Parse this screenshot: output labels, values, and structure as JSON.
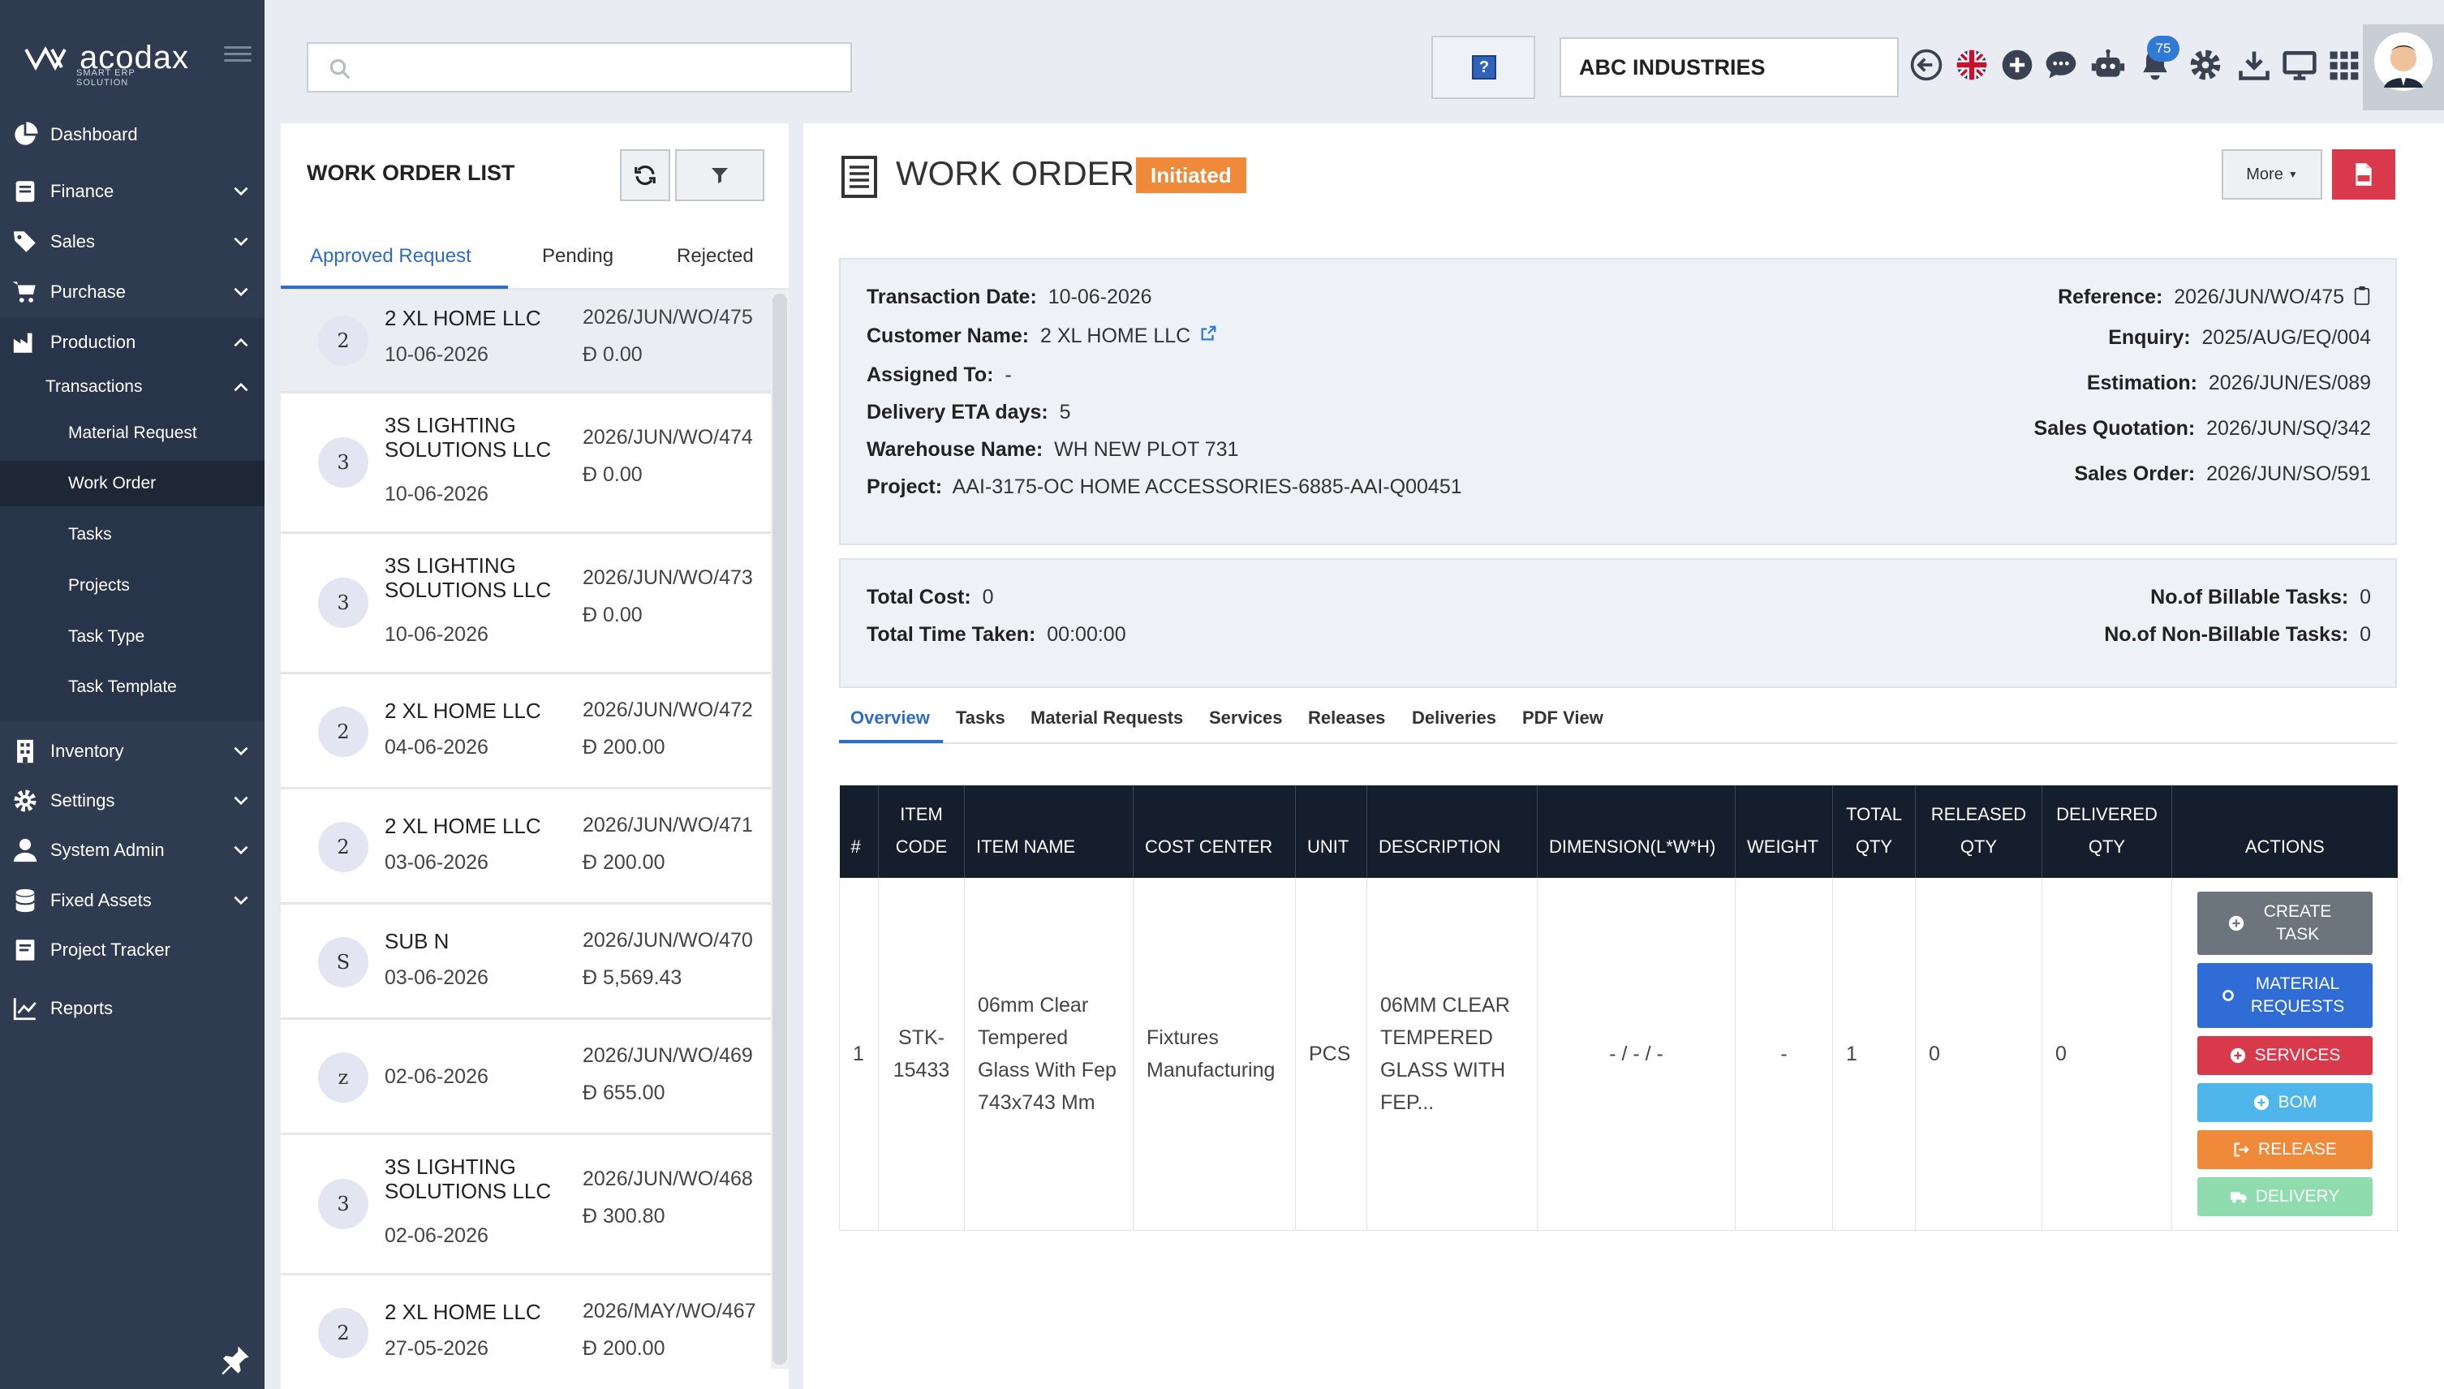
{
  "app": {
    "brand": "acodax",
    "brand_sub": "SMART ERP SOLUTION",
    "company": "ABC INDUSTRIES",
    "notification_count": "75",
    "search": {
      "placeholder": "",
      "value": ""
    },
    "help_label": "?"
  },
  "sidebar": {
    "items": [
      {
        "label": "Dashboard",
        "icon": "pie-chart-icon"
      },
      {
        "label": "Finance",
        "icon": "ledger-icon"
      },
      {
        "label": "Sales",
        "icon": "tags-icon"
      },
      {
        "label": "Purchase",
        "icon": "cart-icon"
      },
      {
        "label": "Production",
        "icon": "factory-icon"
      },
      {
        "label": "Inventory",
        "icon": "building-icon"
      },
      {
        "label": "Settings",
        "icon": "gear-icon"
      },
      {
        "label": "System Admin",
        "icon": "user-icon"
      },
      {
        "label": "Fixed Assets",
        "icon": "database-icon"
      },
      {
        "label": "Project Tracker",
        "icon": "book-icon"
      },
      {
        "label": "Reports",
        "icon": "line-chart-icon"
      }
    ],
    "transactions_label": "Transactions",
    "sub_items": [
      "Material Request",
      "Work Order",
      "Tasks",
      "Projects",
      "Task Type",
      "Task Template"
    ],
    "active_sub": "Work Order"
  },
  "list": {
    "title": "WORK ORDER LIST",
    "tabs": [
      "Approved Request",
      "Pending",
      "Rejected"
    ],
    "active_tab": "Approved Request",
    "currency_symbol": "Ð",
    "items": [
      {
        "initial": "2",
        "name": "2 XL HOME LLC",
        "date": "10-06-2026",
        "number": "2026/JUN/WO/475",
        "amount": "0.00"
      },
      {
        "initial": "3",
        "name": "3S LIGHTING SOLUTIONS LLC",
        "date": "10-06-2026",
        "number": "2026/JUN/WO/474",
        "amount": "0.00"
      },
      {
        "initial": "3",
        "name": "3S LIGHTING SOLUTIONS LLC",
        "date": "10-06-2026",
        "number": "2026/JUN/WO/473",
        "amount": "0.00"
      },
      {
        "initial": "2",
        "name": "2 XL HOME LLC",
        "date": "04-06-2026",
        "number": "2026/JUN/WO/472",
        "amount": "200.00"
      },
      {
        "initial": "2",
        "name": "2 XL HOME LLC",
        "date": "03-06-2026",
        "number": "2026/JUN/WO/471",
        "amount": "200.00"
      },
      {
        "initial": "S",
        "name": "SUB N",
        "date": "03-06-2026",
        "number": "2026/JUN/WO/470",
        "amount": "5,569.43"
      },
      {
        "initial": "z",
        "name": "",
        "date": "02-06-2026",
        "number": "2026/JUN/WO/469",
        "amount": "655.00"
      },
      {
        "initial": "3",
        "name": "3S LIGHTING SOLUTIONS LLC",
        "date": "02-06-2026",
        "number": "2026/JUN/WO/468",
        "amount": "300.80"
      },
      {
        "initial": "2",
        "name": "2 XL HOME LLC",
        "date": "27-05-2026",
        "number": "2026/MAY/WO/467",
        "amount": "200.00"
      }
    ]
  },
  "detail": {
    "title": "WORK ORDER",
    "status": "Initiated",
    "more_label": "More",
    "info_left": [
      {
        "label": "Transaction Date:",
        "value": "10-06-2026"
      },
      {
        "label": "Customer Name:",
        "value": "2 XL HOME LLC"
      },
      {
        "label": "Assigned To:",
        "value": "-"
      },
      {
        "label": "Delivery ETA days:",
        "value": "5"
      },
      {
        "label": "Warehouse Name:",
        "value": "WH NEW PLOT 731"
      },
      {
        "label": "Project:",
        "value": "AAI-3175-OC HOME ACCESSORIES-6885-AAI-Q00451"
      }
    ],
    "info_right": [
      {
        "label": "Reference:",
        "value": "2026/JUN/WO/475"
      },
      {
        "label": "Enquiry:",
        "value": "2025/AUG/EQ/004"
      },
      {
        "label": "Estimation:",
        "value": "2026/JUN/ES/089"
      },
      {
        "label": "Sales Quotation:",
        "value": "2026/JUN/SQ/342"
      },
      {
        "label": "Sales Order:",
        "value": "2026/JUN/SO/591"
      }
    ],
    "costs_left": [
      {
        "label": "Total Cost:",
        "value": "0"
      },
      {
        "label": "Total Time Taken:",
        "value": "00:00:00"
      }
    ],
    "costs_right": [
      {
        "label": "No.of Billable Tasks:",
        "value": "0"
      },
      {
        "label": "No.of Non-Billable Tasks:",
        "value": "0"
      }
    ],
    "tabs": [
      "Overview",
      "Tasks",
      "Material Requests",
      "Services",
      "Releases",
      "Deliveries",
      "PDF View"
    ],
    "active_tab": "Overview",
    "table": {
      "headers": [
        "#",
        "ITEM CODE",
        "ITEM NAME",
        "COST CENTER",
        "UNIT",
        "DESCRIPTION",
        "DIMENSION(L*W*H)",
        "WEIGHT",
        "TOTAL QTY",
        "RELEASED QTY",
        "DELIVERED QTY",
        "ACTIONS"
      ],
      "rows": [
        {
          "no": "1",
          "item_code": "STK-15433",
          "item_name": "06mm Clear Tempered Glass With Fep 743x743 Mm",
          "cost_center": "Fixtures Manufacturing",
          "unit": "PCS",
          "description": "06MM CLEAR TEMPERED GLASS WITH FEP...",
          "dimension": "- / - / -",
          "weight": "-",
          "total_qty": "1",
          "released_qty": "0",
          "delivered_qty": "0"
        }
      ],
      "actions": [
        {
          "label": "CREATE TASK",
          "color": "#6c757d"
        },
        {
          "label": "MATERIAL REQUESTS",
          "color": "#2f6cd6"
        },
        {
          "label": "SERVICES",
          "color": "#d83a4b"
        },
        {
          "label": "BOM",
          "color": "#4fb6ec"
        },
        {
          "label": "RELEASE",
          "color": "#ef8a3a"
        },
        {
          "label": "DELIVERY",
          "color": "#8fdcae"
        }
      ]
    }
  }
}
